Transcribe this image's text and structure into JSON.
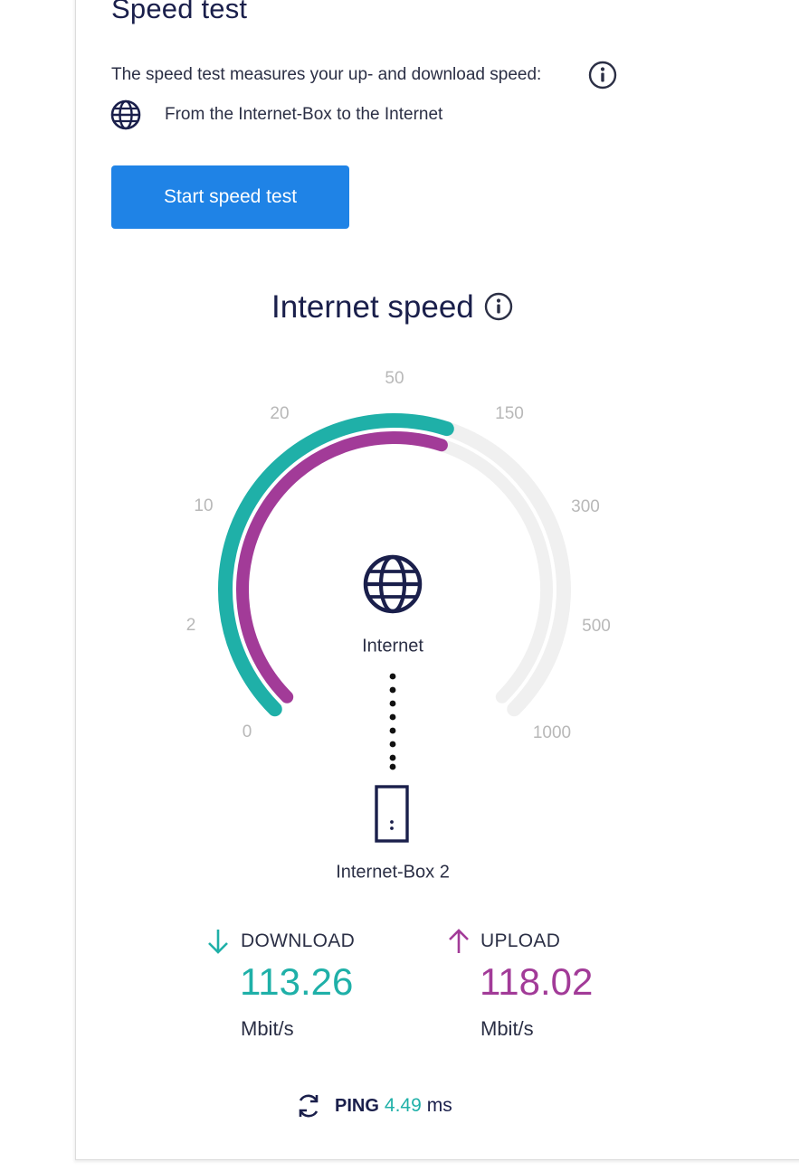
{
  "page": {
    "title": "Speed test",
    "description": "The speed test measures your up- and download speed:",
    "route_text": "From the Internet-Box to the Internet",
    "start_button_label": "Start speed test"
  },
  "gauge": {
    "title": "Internet speed",
    "scale_labels": [
      "0",
      "2",
      "10",
      "20",
      "50",
      "150",
      "300",
      "500",
      "1000"
    ],
    "center_label": "Internet",
    "device_label": "Internet-Box 2",
    "colors": {
      "download": "#1fb0a8",
      "upload": "#a23b98",
      "track": "#f0f0f0"
    }
  },
  "download": {
    "label": "DOWNLOAD",
    "value": "113.26",
    "unit": "Mbit/s"
  },
  "upload": {
    "label": "UPLOAD",
    "value": "118.02",
    "unit": "Mbit/s"
  },
  "ping": {
    "label": "PING",
    "value": "4.49",
    "unit": "ms"
  },
  "icons": {
    "info": "info-icon",
    "globe": "globe-icon",
    "router": "router-icon",
    "refresh": "refresh-icon",
    "arrow_down": "arrow-down-icon",
    "arrow_up": "arrow-up-icon"
  }
}
